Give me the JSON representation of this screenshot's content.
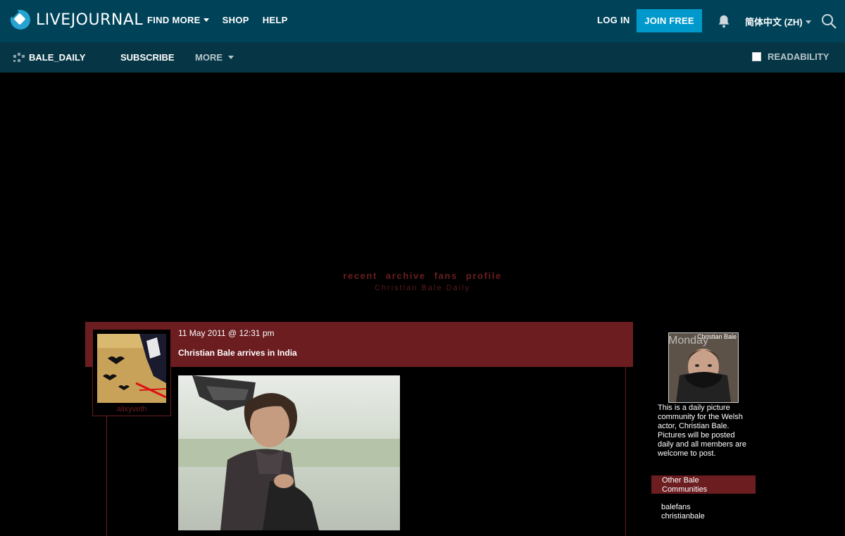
{
  "header": {
    "logo_text": "LIVEJOURNAL",
    "nav": [
      "FIND MORE",
      "SHOP",
      "HELP"
    ],
    "login": "LOG IN",
    "join": "JOIN FREE",
    "language": "简体中文 (ZH)"
  },
  "subheader": {
    "community": "BALE_DAILY",
    "subscribe": "SUBSCRIBE",
    "more": "MORE",
    "readability": "READABILITY"
  },
  "journal": {
    "links": [
      "recent",
      "archive",
      "fans",
      "profile"
    ],
    "title": "Christian Bale Daily"
  },
  "post": {
    "date": "11 May 2011 @ 12:31 pm",
    "title": "Christian Bale arrives in India",
    "username": "alixyveth"
  },
  "sidebar": {
    "pic_label": "Christian Bale",
    "pic_day": "Monday",
    "description": "This is a daily picture community for the Welsh actor, Christian Bale. Pictures will be posted daily and all members are welcome to post.",
    "section_title": "Other Bale Communities",
    "links": [
      "balefans",
      "christianbale"
    ]
  },
  "colors": {
    "topbar": "#004359",
    "subbar": "#063645",
    "accent": "#0099cc",
    "journal_red": "#6b1d20"
  }
}
